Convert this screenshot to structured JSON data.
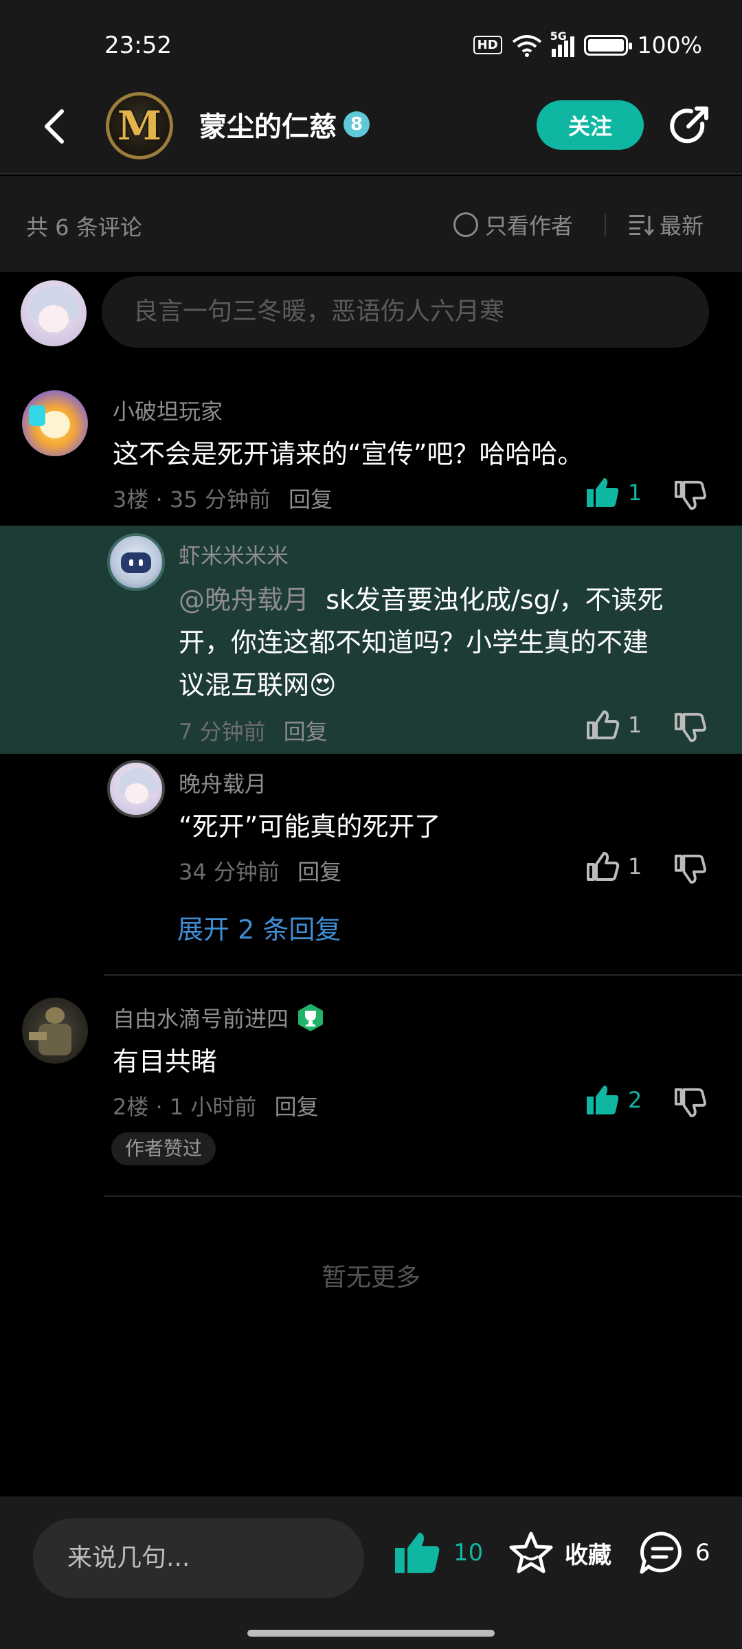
{
  "status_bar": {
    "time": "23:52",
    "hd": "HD",
    "network": "5G",
    "battery": "100%"
  },
  "header": {
    "avatar_letter": "M",
    "name": "蒙尘的仁慈",
    "level": "8",
    "follow_label": "关注"
  },
  "filter": {
    "count_text": "共 6 条评论",
    "only_author": "只看作者",
    "sort": "最新"
  },
  "comment_input": {
    "placeholder": "良言一句三冬暖，恶语伤人六月寒"
  },
  "comments": [
    {
      "author": "小破坦玩家",
      "text": "这不会是死开请来的“宣传”吧？哈哈哈。",
      "floor": "3楼",
      "time": "35 分钟前",
      "reply": "回复",
      "likes": "1",
      "replies": [
        {
          "author": "虾米米米米",
          "mention": "@晚舟载月",
          "text_line1": "sk发音要浊化成/sg/，不读死",
          "text_line2": "开，你连这都不知道吗？小学生真的不建",
          "text_line3": "议混互联网",
          "emoji": "😍",
          "time": "7 分钟前",
          "reply": "回复",
          "likes": "1"
        },
        {
          "author": "晚舟载月",
          "text": "“死开”可能真的死开了",
          "time": "34 分钟前",
          "reply": "回复",
          "likes": "1"
        }
      ],
      "expand": "展开 2 条回复"
    },
    {
      "author": "自由水滴号前进四",
      "text": "有目共睹",
      "floor": "2楼",
      "time": "1 小时前",
      "reply": "回复",
      "likes": "2",
      "badge": "作者赞过"
    }
  ],
  "no_more": "暂无更多",
  "bottom_bar": {
    "say_placeholder": "来说几句...",
    "likes": "10",
    "favorite": "收藏",
    "comments": "6"
  },
  "colors": {
    "accent": "#0fb7a3",
    "highlight": "#1d3c36",
    "link": "#3f8fd6"
  }
}
